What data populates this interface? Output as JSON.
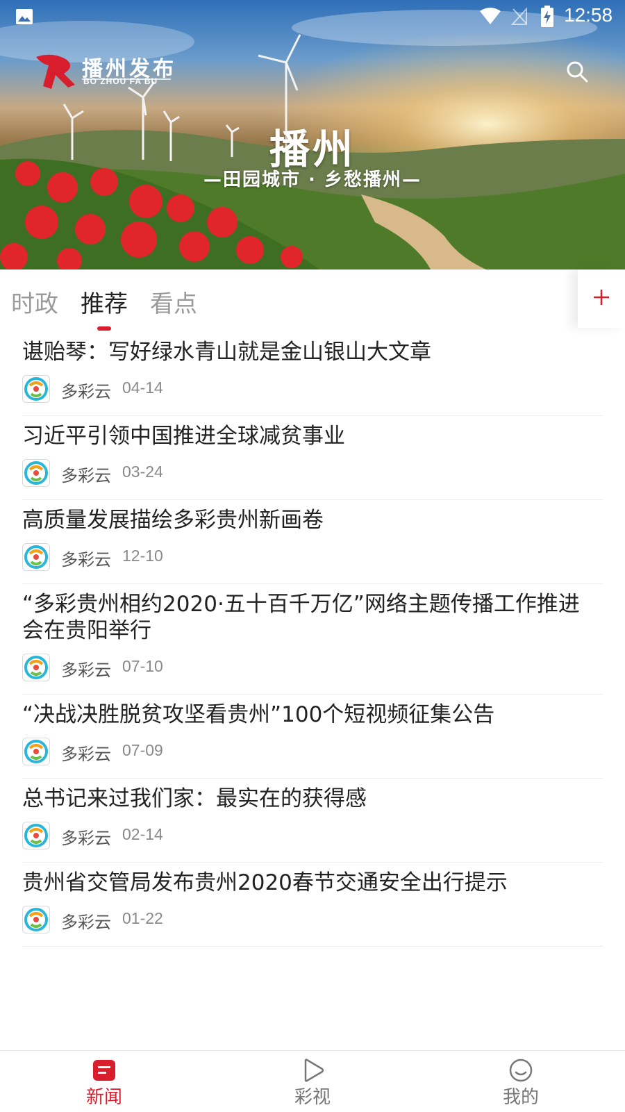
{
  "status_bar": {
    "time": "12:58",
    "icons": [
      "gallery-icon",
      "wifi-icon",
      "no-sim-icon",
      "battery-charging-icon"
    ]
  },
  "header": {
    "brand_name": "播州发布",
    "brand_sub": "BO ZHOU FA BU",
    "banner_title": "播州",
    "banner_slogan": "—田园城市 · 乡愁播州—",
    "search_icon": "search-icon"
  },
  "tabs": [
    {
      "label": "时政",
      "active": false
    },
    {
      "label": "推荐",
      "active": true
    },
    {
      "label": "看点",
      "active": false
    }
  ],
  "add_channel_icon": "plus-icon",
  "colors": {
    "accent": "#d81e2c",
    "text": "#222222",
    "muted": "#8a8a8a"
  },
  "news": [
    {
      "title": "谌贻琴：写好绿水青山就是金山银山大文章",
      "source": "多彩云",
      "date": "04-14"
    },
    {
      "title": "习近平引领中国推进全球减贫事业",
      "source": "多彩云",
      "date": "03-24"
    },
    {
      "title": "高质量发展描绘多彩贵州新画卷",
      "source": "多彩云",
      "date": "12-10"
    },
    {
      "title": "“多彩贵州相约2020·五十百千万亿”网络主题传播工作推进会在贵阳举行",
      "source": "多彩云",
      "date": "07-10"
    },
    {
      "title": "“决战决胜脱贫攻坚看贵州”100个短视频征集公告",
      "source": "多彩云",
      "date": "07-09"
    },
    {
      "title": "总书记来过我们家：最实在的获得感",
      "source": "多彩云",
      "date": "02-14"
    },
    {
      "title": "贵州省交管局发布贵州2020春节交通安全出行提示",
      "source": "多彩云",
      "date": "01-22"
    }
  ],
  "bottom_nav": [
    {
      "label": "新闻",
      "icon": "news-icon",
      "active": true
    },
    {
      "label": "彩视",
      "icon": "play-icon",
      "active": false
    },
    {
      "label": "我的",
      "icon": "smile-icon",
      "active": false
    }
  ]
}
